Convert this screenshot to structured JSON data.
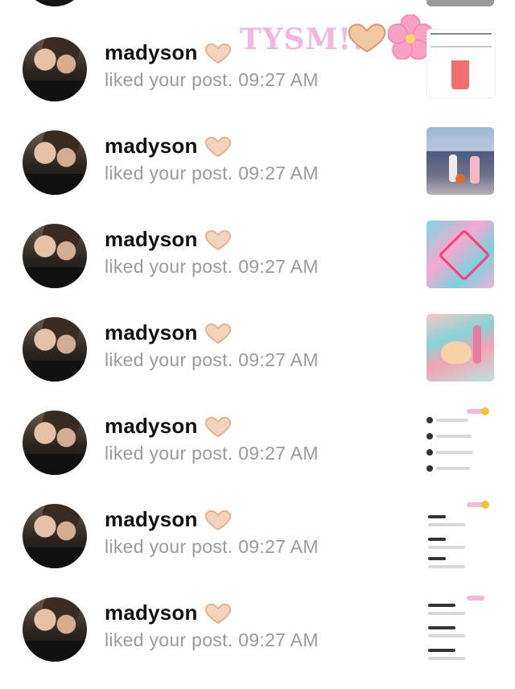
{
  "overlay": {
    "text": "TYSM!!"
  },
  "notifications": [
    {
      "name": "madyson",
      "message": "liked your post.",
      "time": "09:27 AM",
      "thumb": "perfume-product"
    },
    {
      "name": "madyson",
      "message": "liked your post.",
      "time": "09:27 AM",
      "thumb": "street-photo"
    },
    {
      "name": "madyson",
      "message": "liked your post.",
      "time": "09:27 AM",
      "thumb": "pink-collage"
    },
    {
      "name": "madyson",
      "message": "liked your post.",
      "time": "09:27 AM",
      "thumb": "sea-collage"
    },
    {
      "name": "madyson",
      "message": "liked your post.",
      "time": "09:27 AM",
      "thumb": "notification-list"
    },
    {
      "name": "madyson",
      "message": "liked your post.",
      "time": "09:27 AM",
      "thumb": "notification-list"
    },
    {
      "name": "madyson",
      "message": "liked your post.",
      "time": "09:27 AM",
      "thumb": "notification-list"
    }
  ]
}
